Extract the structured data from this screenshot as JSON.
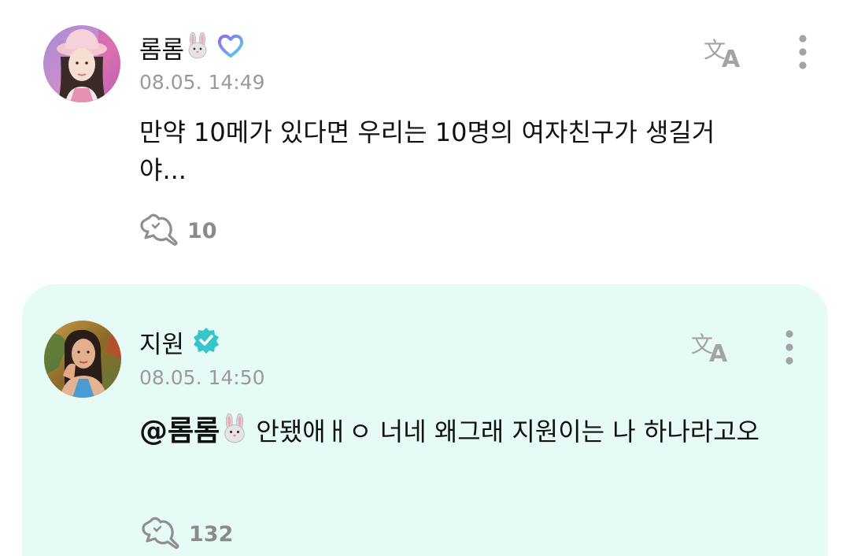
{
  "post": {
    "author": "롬롬",
    "author_emoji": "rabbit-face-emoji",
    "badge": "weverse-heart-badge",
    "timestamp": "08.05. 14:49",
    "body": "만약 10메가 있다면 우리는 10명의 여자친구가 생길거야...",
    "likes": "10",
    "translate_icon": "translate-icon",
    "more_icon": "more-vertical-icon"
  },
  "reply": {
    "author": "지원",
    "badge": "verified-badge",
    "timestamp": "08.05. 14:50",
    "mention": "@롬롬",
    "mention_emoji": "rabbit-face-emoji",
    "body": " 안됐애ㅐㅇ 너네 왜그래 지원이는 나 하나라고오",
    "likes": "132",
    "translate_icon": "translate-icon",
    "more_icon": "more-vertical-icon"
  },
  "colors": {
    "reply_background": "#e7fbf6",
    "verified_badge": "#36c5c9",
    "weverse_gradient_start": "#8a6cf0",
    "weverse_gradient_end": "#5bd0e8",
    "muted_text": "#9a9a9a",
    "icon_gray": "#a3a3a3"
  }
}
